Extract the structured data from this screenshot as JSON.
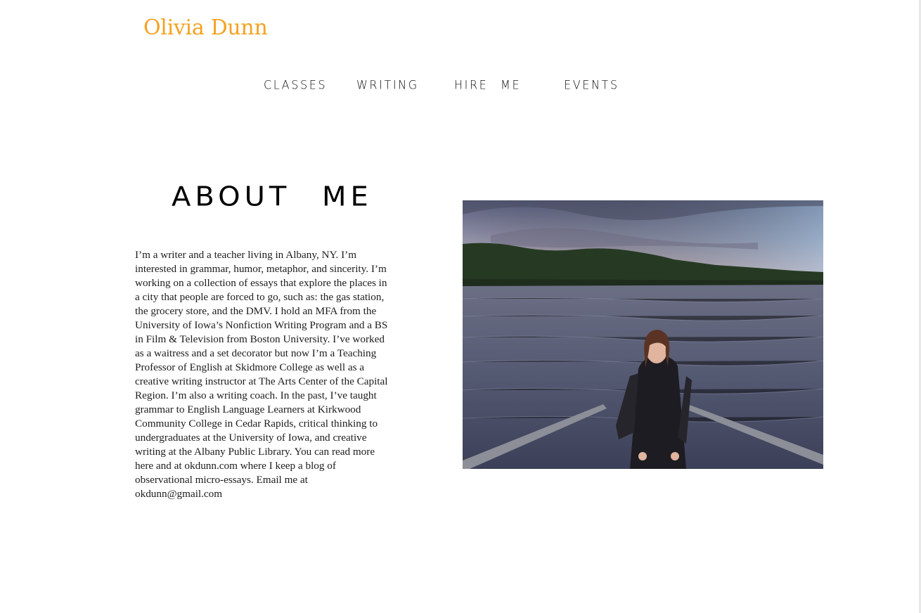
{
  "header": {
    "site_title": "Olivia Dunn"
  },
  "nav": {
    "items": [
      {
        "label": "CLASSES"
      },
      {
        "label": "WRITING"
      },
      {
        "label": "HIRE ME"
      },
      {
        "label": "EVENTS"
      }
    ]
  },
  "about": {
    "heading": "ABOUT ME",
    "body": "I’m a writer and a teacher living in Albany, NY. I’m interested in grammar, humor, metaphor, and sincerity. I’m working on a collection of essays that explore the places in a city that people are forced to go, such as: the gas station, the grocery store, and the DMV. I hold an MFA from the University of Iowa’s Nonfiction Writing Program and a BS in Film & Television from Boston University. I’ve worked as a waitress and a set decorator but now I’m a Teaching Professor of English at Skidmore College as well as a creative writing instructor at The Arts Center of the Capital Region. I’m also a writing coach. In the past, I’ve taught grammar to English Language Learners at Kirkwood Community College in Cedar Rapids, critical thinking to undergraduates at the University of Iowa, and creative writing at the Albany Public Library. You can read more here and at okdunn.com where I keep a blog of observational micro-essays. Email me at okdunn@gmail.com"
  },
  "colors": {
    "accent": "#f5a221",
    "text": "#1c1c1c",
    "background": "#ffffff"
  }
}
